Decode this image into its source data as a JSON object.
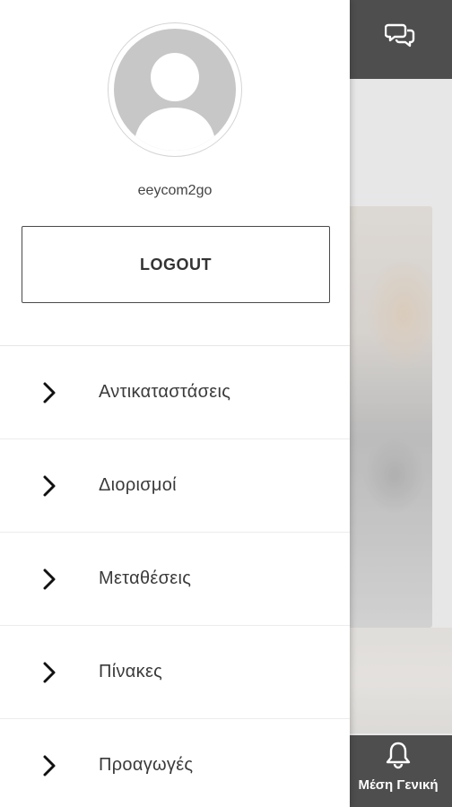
{
  "drawer": {
    "username": "eeycom2go",
    "logout_label": "LOGOUT",
    "menu": [
      {
        "label": "Αντικαταστάσεις",
        "icon": "chevron-right-icon"
      },
      {
        "label": "Διορισμοί",
        "icon": "chevron-right-icon"
      },
      {
        "label": "Μεταθέσεις",
        "icon": "chevron-right-icon"
      },
      {
        "label": "Πίνακες",
        "icon": "chevron-right-icon"
      },
      {
        "label": "Προαγωγές",
        "icon": "chevron-right-icon"
      }
    ]
  },
  "background": {
    "top_icon": "chat-bubbles-icon",
    "bottom_nav": {
      "icon": "bell-icon",
      "label": "Μέση Γενική"
    }
  },
  "colors": {
    "topbar": "#0a0a0a",
    "drawer_bg": "#ffffff",
    "avatar_fill": "#c7c7c7",
    "text": "#3a3a3a"
  }
}
